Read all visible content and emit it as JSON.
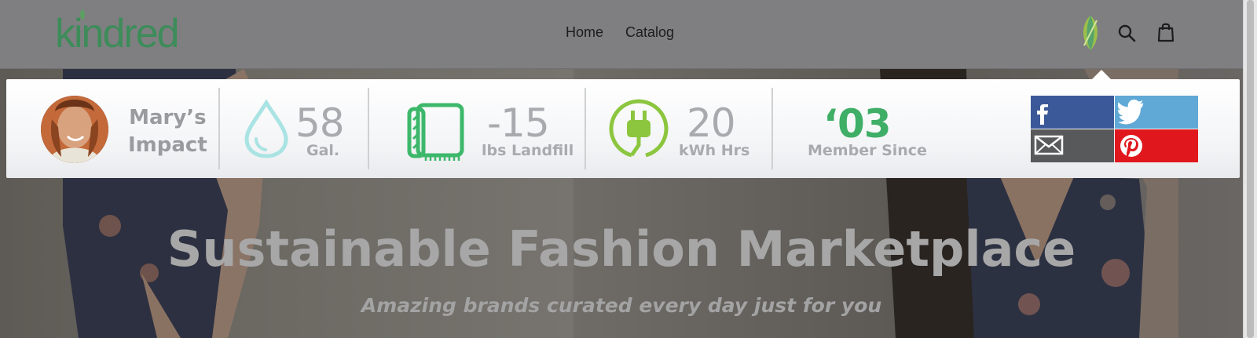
{
  "header": {
    "logo_text": "kindred",
    "nav": [
      {
        "label": "Home"
      },
      {
        "label": "Catalog"
      }
    ],
    "icons": [
      "leaf-icon",
      "search-icon",
      "cart-icon"
    ]
  },
  "impact": {
    "profile_label_line1": "Mary’s",
    "profile_label_line2": "Impact",
    "stats": [
      {
        "value": "58",
        "unit": "Gal.",
        "icon": "water-drop-icon",
        "color": "#a9e3e3"
      },
      {
        "value": "-15",
        "unit": "lbs Landfill",
        "icon": "towel-icon",
        "color": "#3db86b"
      },
      {
        "value": "20",
        "unit": "kWh Hrs",
        "icon": "plug-icon",
        "color": "#8cc63f"
      }
    ],
    "member_year": "‘03",
    "member_label": "Member Since",
    "share": [
      {
        "network": "facebook",
        "icon": "facebook-icon",
        "color": "#3b5998"
      },
      {
        "network": "twitter",
        "icon": "twitter-icon",
        "color": "#60a9d6"
      },
      {
        "network": "email",
        "icon": "email-icon",
        "color": "#58595b"
      },
      {
        "network": "pinterest",
        "icon": "pinterest-icon",
        "color": "#e0181e"
      }
    ]
  },
  "hero": {
    "title": "Sustainable Fashion Marketplace",
    "subtitle": "Amazing brands curated every day just for you"
  },
  "colors": {
    "accent_green": "#3fae66",
    "panel_text": "#a9aaad"
  }
}
